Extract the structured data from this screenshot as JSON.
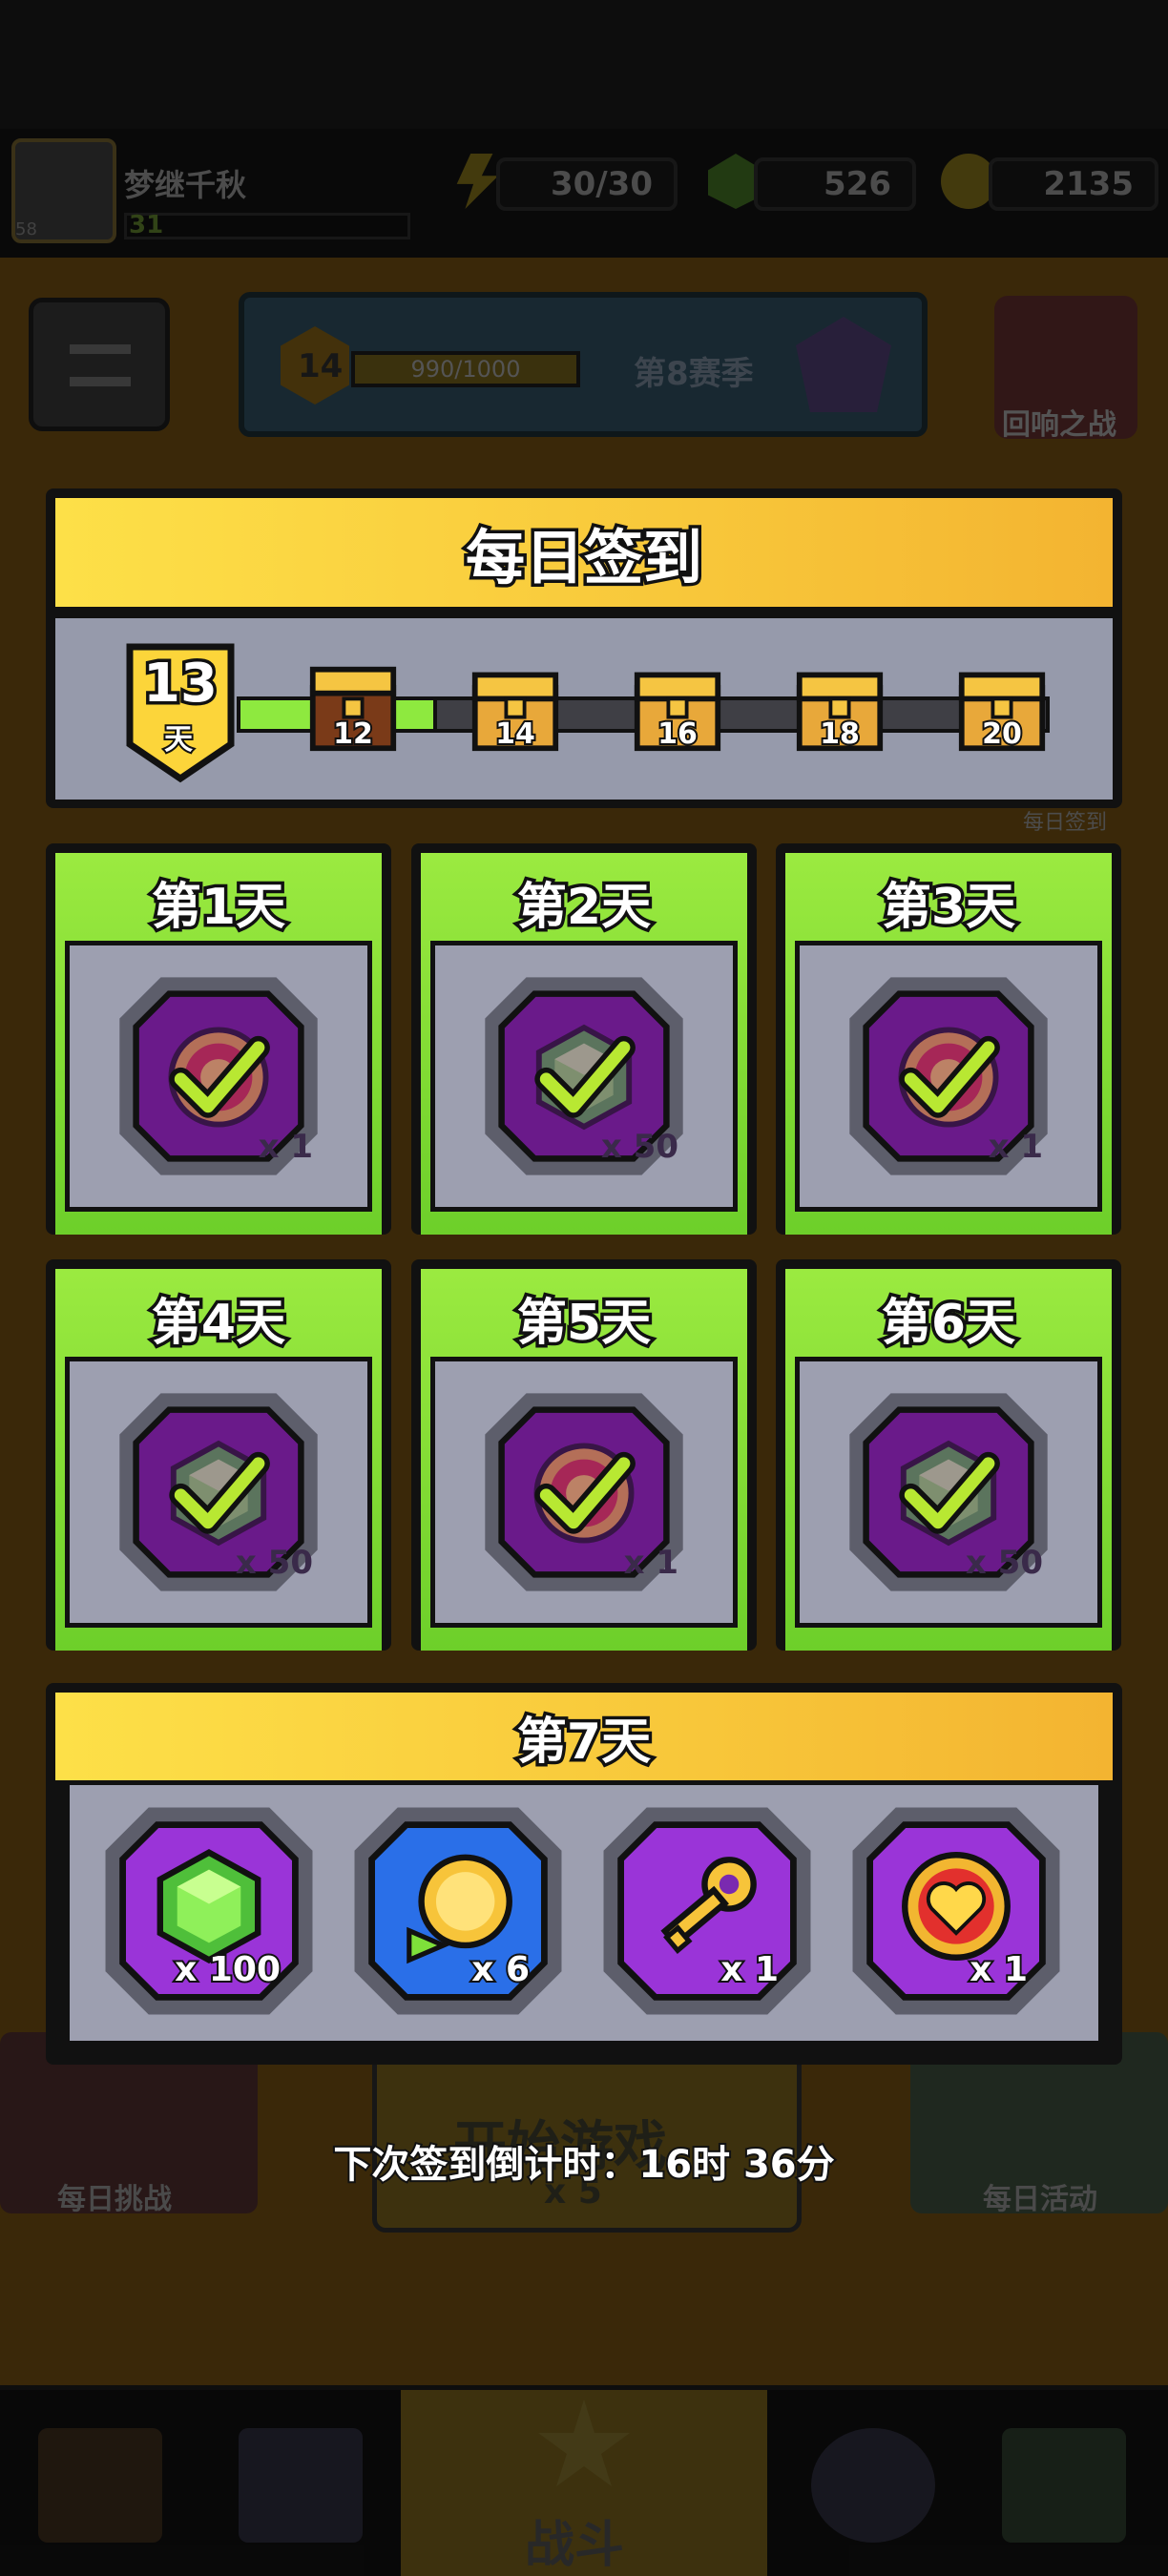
{
  "hud": {
    "player_name": "梦继千秋",
    "player_level": "31",
    "avatar_level": "58",
    "energy": "30/30",
    "gems": "526",
    "coins": "2135"
  },
  "season": {
    "level": "14",
    "xp": "990/1000",
    "name": "第8赛季"
  },
  "side": {
    "echo_battle": "回响之战",
    "daily_checkin_small": "每日签到",
    "daily_challenge": "每日挑战",
    "daily_event": "每日活动"
  },
  "dialog": {
    "title": "每日签到",
    "streak_days": "13",
    "streak_unit": "天",
    "milestones": [
      "12",
      "14",
      "16",
      "18",
      "20"
    ]
  },
  "days": [
    {
      "label": "第1天",
      "reward": "coin-badge",
      "qty": "x 1",
      "claimed": true
    },
    {
      "label": "第2天",
      "reward": "gem",
      "qty": "x 50",
      "claimed": true
    },
    {
      "label": "第3天",
      "reward": "coin-badge",
      "qty": "x 1",
      "claimed": true
    },
    {
      "label": "第4天",
      "reward": "gem",
      "qty": "x 50",
      "claimed": true
    },
    {
      "label": "第5天",
      "reward": "coin-badge",
      "qty": "x 1",
      "claimed": true
    },
    {
      "label": "第6天",
      "reward": "gem",
      "qty": "x 50",
      "claimed": true
    }
  ],
  "day7": {
    "label": "第7天",
    "rewards": [
      {
        "item": "gem",
        "qty": "x 100"
      },
      {
        "item": "coin-refresh",
        "qty": "x 6"
      },
      {
        "item": "key",
        "qty": "x 1"
      },
      {
        "item": "heart-badge",
        "qty": "x 1"
      }
    ]
  },
  "countdown": "下次签到倒计时：16时 36分",
  "background": {
    "start_button": "开始游戏",
    "start_cost": "x 5",
    "battle_tab": "战斗"
  },
  "colors": {
    "yellow": "#f8c73a",
    "green": "#8ee93f",
    "purple": "#7b1fa2",
    "panel_gray": "#9d9fb0"
  }
}
